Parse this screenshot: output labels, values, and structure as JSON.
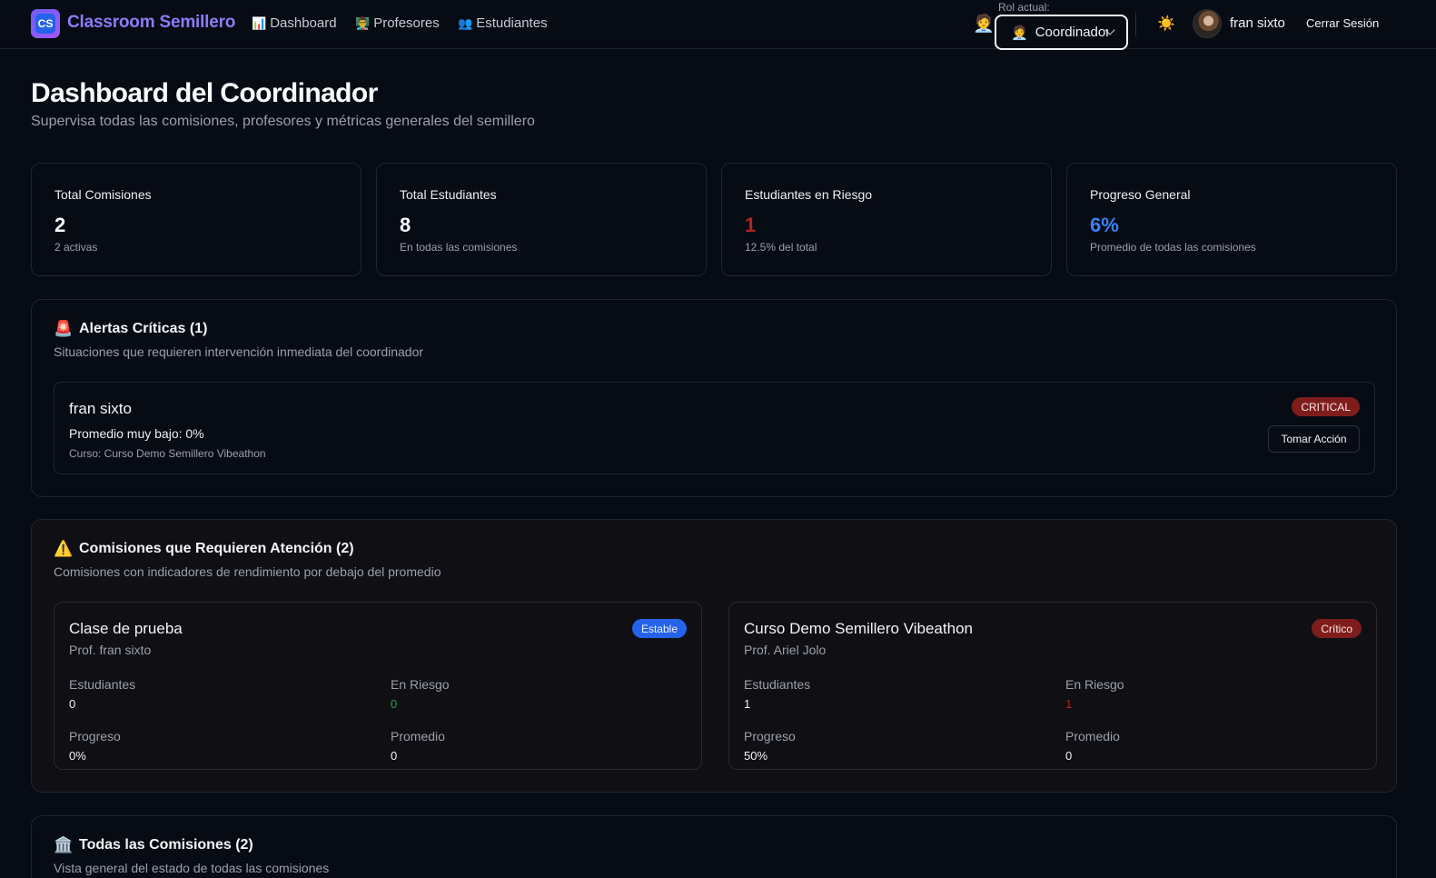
{
  "nav": {
    "logo_text": "CS",
    "brand": "Classroom Semillero",
    "links": [
      {
        "icon": "📊",
        "label": "Dashboard"
      },
      {
        "icon": "👨‍🏫",
        "label": "Profesores"
      },
      {
        "icon": "👥",
        "label": "Estudiantes"
      }
    ],
    "role_label": "Rol actual:",
    "role_icon": "🧑‍💼",
    "role_value": "Coordinador",
    "theme_icon": "☀️",
    "user_name": "fran sixto",
    "logout": "Cerrar Sesión"
  },
  "header": {
    "title": "Dashboard del Coordinador",
    "subtitle": "Supervisa todas las comisiones, profesores y métricas generales del semillero"
  },
  "stats": [
    {
      "label": "Total Comisiones",
      "value": "2",
      "sub": "2 activas",
      "color": "#f9fafb"
    },
    {
      "label": "Total Estudiantes",
      "value": "8",
      "sub": "En todas las comisiones",
      "color": "#f9fafb"
    },
    {
      "label": "Estudiantes en Riesgo",
      "value": "1",
      "sub": "12.5% del total",
      "color": "#b42323"
    },
    {
      "label": "Progreso General",
      "value": "6%",
      "sub": "Promedio de todas las comisiones",
      "color": "#3b82f6"
    }
  ],
  "alerts": {
    "icon": "🚨",
    "title": "Alertas Críticas (1)",
    "description": "Situaciones que requieren intervención inmediata del coordinador",
    "items": [
      {
        "name": "fran sixto",
        "message": "Promedio muy bajo: 0%",
        "course": "Curso: Curso Demo Semillero Vibeathon",
        "severity": "CRITICAL",
        "action": "Tomar Acción"
      }
    ]
  },
  "attention": {
    "icon": "⚠️",
    "title": "Comisiones que Requieren Atención (2)",
    "description": "Comisiones con indicadores de rendimiento por debajo del promedio",
    "labels": {
      "students": "Estudiantes",
      "risk": "En Riesgo",
      "progress": "Progreso",
      "average": "Promedio"
    },
    "cards": [
      {
        "title": "Clase de prueba",
        "prof": "Prof. fran sixto",
        "status": "Estable",
        "students": "0",
        "risk": "0",
        "risk_color": "#22a34a",
        "progress": "0%",
        "average": "0"
      },
      {
        "title": "Curso Demo Semillero Vibeathon",
        "prof": "Prof. Ariel Jolo",
        "status": "Crítico",
        "students": "1",
        "risk": "1",
        "risk_color": "#b42323",
        "progress": "50%",
        "average": "0"
      }
    ]
  },
  "all_commissions": {
    "icon": "🏛️",
    "title": "Todas las Comisiones (2)",
    "description": "Vista general del estado de todas las comisiones"
  }
}
